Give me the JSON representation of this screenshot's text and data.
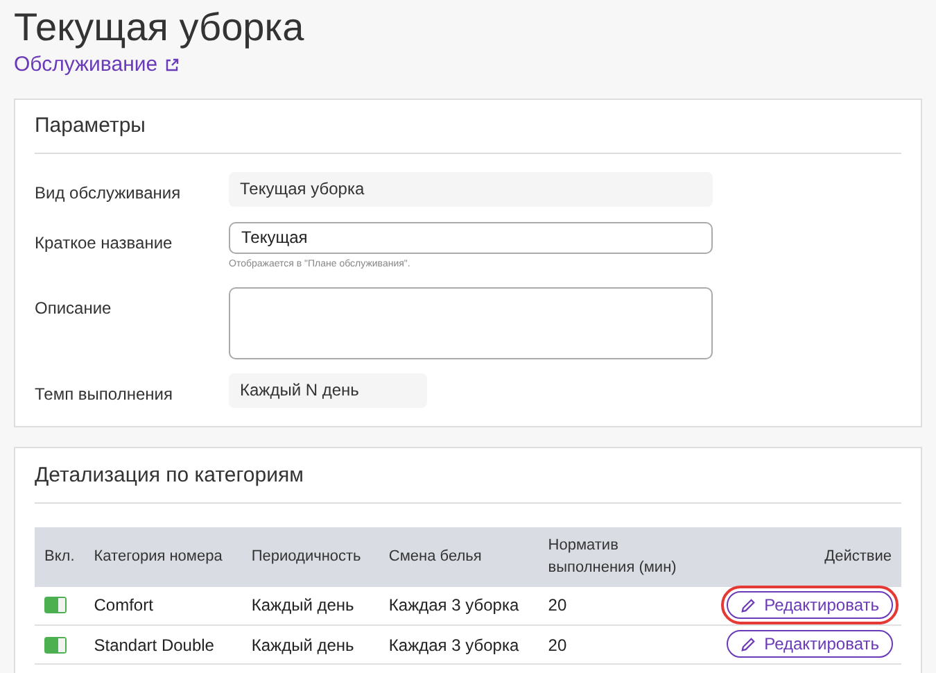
{
  "page": {
    "title": "Текущая уборка",
    "link": "Обслуживание"
  },
  "parameters": {
    "title": "Параметры",
    "fields": [
      {
        "kind": "readonly",
        "label": "Вид обслуживания",
        "value": "Текущая уборка"
      },
      {
        "kind": "input",
        "label": "Краткое название",
        "value": "Текущая",
        "hint": "Отображается в \"Плане обслуживания\"."
      },
      {
        "kind": "textarea",
        "label": "Описание"
      },
      {
        "kind": "readonly-short",
        "label": "Темп выполнения",
        "value": "Каждый N день"
      }
    ]
  },
  "categories": {
    "title": "Детализация по категориям",
    "columns": [
      "Вкл.",
      "Категория номера",
      "Периодичность",
      "Смена белья",
      "Норматив выполнения (мин)",
      "Действие"
    ],
    "rows": [
      {
        "on": true,
        "category": "Comfort",
        "period": "Каждый день",
        "linen": "Каждая 3 уборка",
        "norm": "20",
        "action": "Редактировать",
        "highlighted": true
      },
      {
        "on": true,
        "category": "Standart Double",
        "period": "Каждый день",
        "linen": "Каждая 3 уборка",
        "norm": "20",
        "action": "Редактировать",
        "highlighted": false
      }
    ]
  }
}
